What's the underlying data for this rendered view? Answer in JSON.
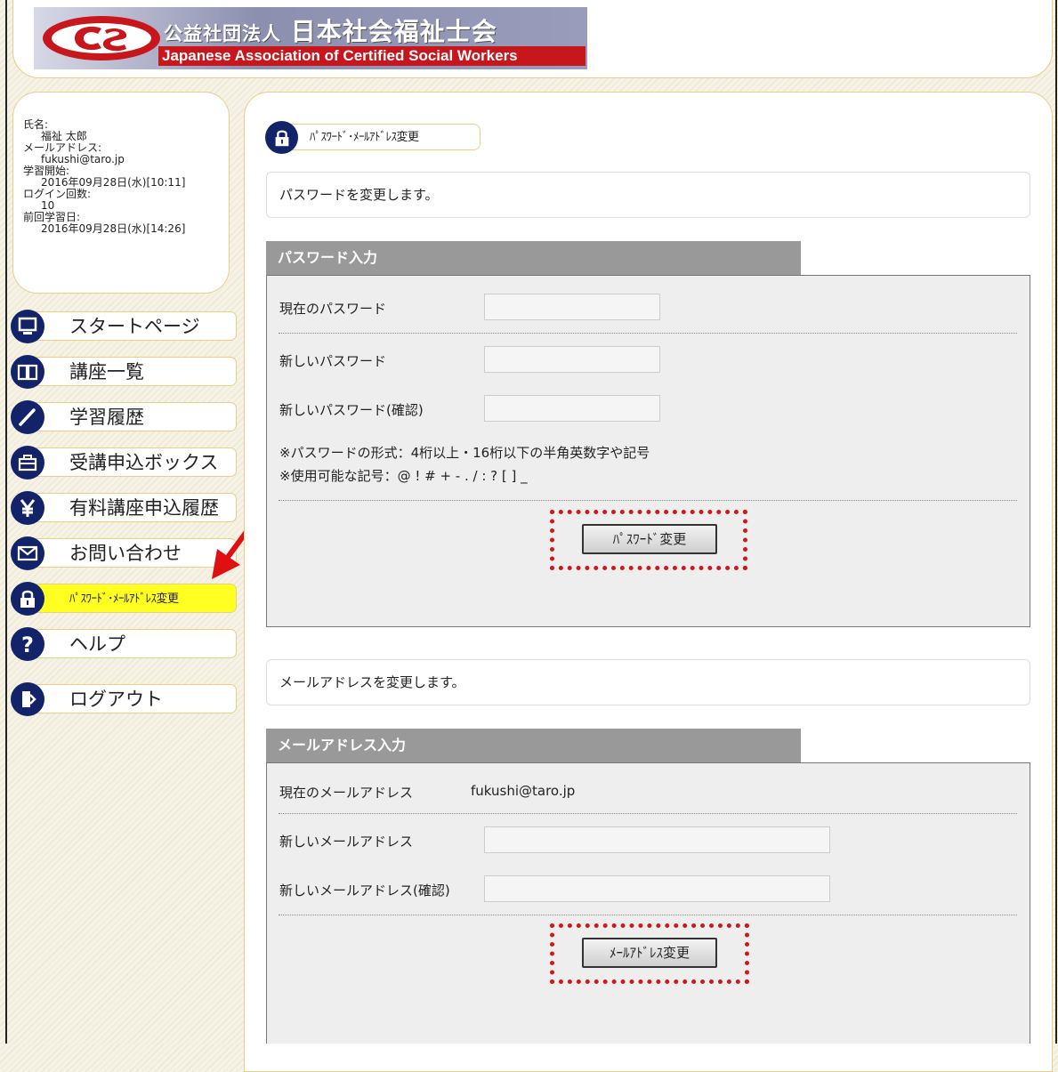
{
  "header": {
    "logo_jp_prefix": "公益社団法人",
    "logo_jp_name": "日本社会福祉士会",
    "logo_en": "Japanese Association of Certified Social Workers"
  },
  "user": {
    "name_label": "氏名:",
    "name": "福祉 太郎",
    "email_label": "メールアドレス:",
    "email": "fukushi@taro.jp",
    "start_label": "学習開始:",
    "start": "2016年09月28日(水)[10:11]",
    "login_label": "ログイン回数:",
    "login": "10",
    "last_label": "前回学習日:",
    "last": "2016年09月28日(水)[14:26]"
  },
  "menu": [
    {
      "label": "スタートページ",
      "icon": "monitor-icon"
    },
    {
      "label": "講座一覧",
      "icon": "book-icon"
    },
    {
      "label": "学習履歴",
      "icon": "pencil-icon"
    },
    {
      "label": "受講申込ボックス",
      "icon": "briefcase-icon"
    },
    {
      "label": "有料講座申込履歴",
      "icon": "yen-icon"
    },
    {
      "label": "お問い合わせ",
      "icon": "envelope-icon"
    },
    {
      "label": "ﾊﾟｽﾜｰﾄﾞ･ﾒｰﾙｱﾄﾞﾚｽ変更",
      "icon": "lock-icon",
      "active": true
    },
    {
      "label": "ヘルプ",
      "icon": "question-icon"
    },
    {
      "label": "ログアウト",
      "icon": "door-icon"
    }
  ],
  "page_title": "ﾊﾟｽﾜｰﾄﾞ･ﾒｰﾙｱﾄﾞﾚｽ変更",
  "password": {
    "note": "パスワードを変更します。",
    "section_title": "パスワード入力",
    "current_label": "現在のパスワード",
    "new_label": "新しいパスワード",
    "confirm_label": "新しいパスワード(確認)",
    "hint1": "※パスワードの形式：4桁以上・16桁以下の半角英数字や記号",
    "hint2": "※使用可能な記号：@ ! # + - . / : ? [ ] _",
    "button": "ﾊﾟｽﾜｰﾄﾞ変更"
  },
  "email": {
    "note": "メールアドレスを変更します。",
    "section_title": "メールアドレス入力",
    "current_label": "現在のメールアドレス",
    "current_value": "fukushi@taro.jp",
    "new_label": "新しいメールアドレス",
    "confirm_label": "新しいメールアドレス(確認)",
    "button": "ﾒｰﾙｱﾄﾞﾚｽ変更"
  },
  "colors": {
    "navy": "#12236a",
    "highlight": "#ffff22",
    "annotation_red": "#d01818",
    "section_gray": "#999999"
  }
}
